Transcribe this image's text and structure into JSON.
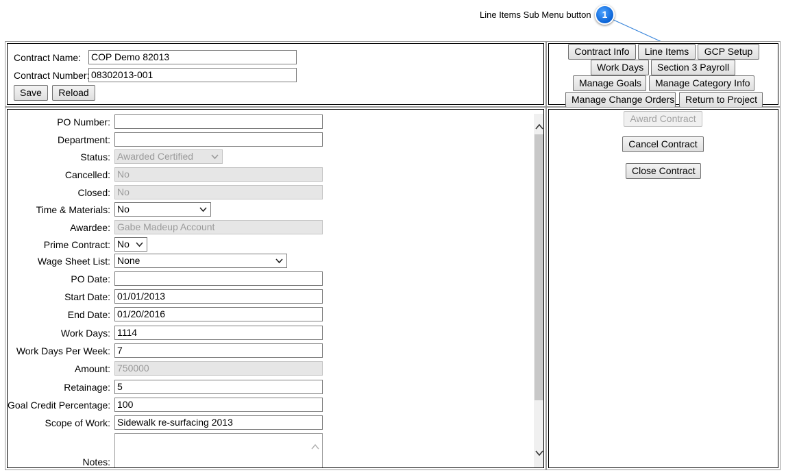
{
  "callout": {
    "text": "Line Items Sub Menu button",
    "number": "1"
  },
  "header": {
    "contract_name_label": "Contract Name:",
    "contract_name_value": "COP Demo 82013",
    "contract_number_label": "Contract Number:",
    "contract_number_value": "08302013-001",
    "save_label": "Save",
    "reload_label": "Reload"
  },
  "menu": {
    "contract_info": "Contract Info",
    "line_items": "Line Items",
    "gcp_setup": "GCP Setup",
    "work_days": "Work Days",
    "section3_payroll": "Section 3 Payroll",
    "manage_goals": "Manage Goals",
    "manage_category_info": "Manage Category Info",
    "manage_change_orders": "Manage Change Orders",
    "return_to_project": "Return to Project"
  },
  "actions": {
    "award_contract": "Award Contract",
    "cancel_contract": "Cancel Contract",
    "close_contract": "Close Contract"
  },
  "form": {
    "po_number": {
      "label": "PO Number:",
      "value": ""
    },
    "department": {
      "label": "Department:",
      "value": ""
    },
    "status": {
      "label": "Status:",
      "value": "Awarded Certified"
    },
    "cancelled": {
      "label": "Cancelled:",
      "value": "No"
    },
    "closed": {
      "label": "Closed:",
      "value": "No"
    },
    "time_materials": {
      "label": "Time & Materials:",
      "value": "No"
    },
    "awardee": {
      "label": "Awardee:",
      "value": "Gabe Madeup Account"
    },
    "prime_contract": {
      "label": "Prime Contract:",
      "value": "No"
    },
    "wage_sheet_list": {
      "label": "Wage Sheet List:",
      "value": "None"
    },
    "po_date": {
      "label": "PO Date:",
      "value": ""
    },
    "start_date": {
      "label": "Start Date:",
      "value": "01/01/2013"
    },
    "end_date": {
      "label": "End Date:",
      "value": "01/20/2016"
    },
    "work_days": {
      "label": "Work Days:",
      "value": "1114"
    },
    "work_days_per_week": {
      "label": "Work Days Per Week:",
      "value": "7"
    },
    "amount": {
      "label": "Amount:",
      "value": "750000"
    },
    "retainage": {
      "label": "Retainage:",
      "value": "5"
    },
    "goal_credit_percentage": {
      "label": "Goal Credit Percentage:",
      "value": "100"
    },
    "scope_of_work": {
      "label": "Scope of Work:",
      "value": "Sidewalk re-surfacing 2013"
    },
    "notes": {
      "label": "Notes:",
      "value": ""
    }
  }
}
